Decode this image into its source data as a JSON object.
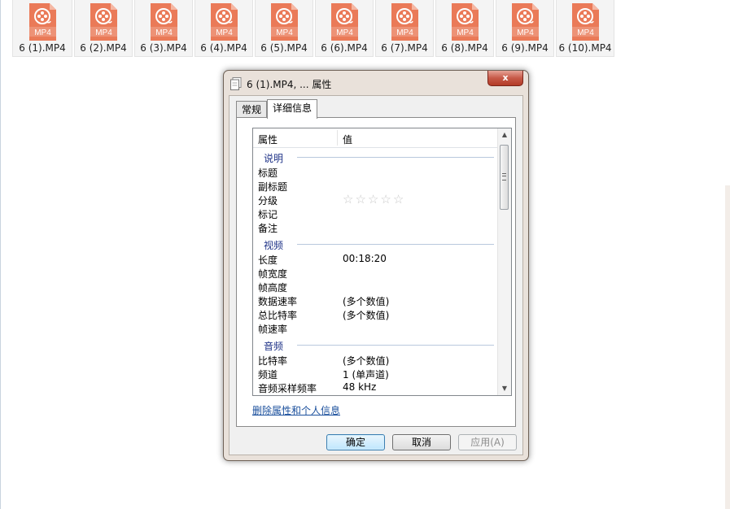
{
  "files": [
    {
      "name": "6 (1).MP4",
      "ext": "MP4"
    },
    {
      "name": "6 (2).MP4",
      "ext": "MP4"
    },
    {
      "name": "6 (3).MP4",
      "ext": "MP4"
    },
    {
      "name": "6 (4).MP4",
      "ext": "MP4"
    },
    {
      "name": "6 (5).MP4",
      "ext": "MP4"
    },
    {
      "name": "6 (6).MP4",
      "ext": "MP4"
    },
    {
      "name": "6 (7).MP4",
      "ext": "MP4"
    },
    {
      "name": "6 (8).MP4",
      "ext": "MP4"
    },
    {
      "name": "6 (9).MP4",
      "ext": "MP4"
    },
    {
      "name": "6 (10).MP4",
      "ext": "MP4"
    }
  ],
  "colors": {
    "file_icon": "#ea7a58",
    "group_heading": "#1e3287",
    "link": "#1a4f9c"
  },
  "dialog": {
    "title": "6 (1).MP4, ... 属性",
    "close_label": "x",
    "title_icon": "document-stack-icon",
    "tabs": [
      {
        "label": "常规"
      },
      {
        "label": "详细信息",
        "active": true
      }
    ],
    "columns": {
      "property": "属性",
      "value": "值"
    },
    "groups": [
      {
        "label": "说明",
        "rows": [
          {
            "key": "标题",
            "value": ""
          },
          {
            "key": "副标题",
            "value": ""
          },
          {
            "key": "分级",
            "value": "",
            "rating": 0,
            "rating_max": 5
          },
          {
            "key": "标记",
            "value": ""
          },
          {
            "key": "备注",
            "value": ""
          }
        ]
      },
      {
        "label": "视频",
        "rows": [
          {
            "key": "长度",
            "value": "00:18:20"
          },
          {
            "key": "帧宽度",
            "value": ""
          },
          {
            "key": "帧高度",
            "value": ""
          },
          {
            "key": "数据速率",
            "value": "(多个数值)"
          },
          {
            "key": "总比特率",
            "value": "(多个数值)"
          },
          {
            "key": "帧速率",
            "value": ""
          }
        ]
      },
      {
        "label": "音频",
        "rows": [
          {
            "key": "比特率",
            "value": "(多个数值)"
          },
          {
            "key": "频道",
            "value": "1 (单声道)"
          },
          {
            "key": "音频采样频率",
            "value": "48 kHz"
          }
        ]
      }
    ],
    "remove_link": "删除属性和个人信息",
    "buttons": {
      "ok": "确定",
      "cancel": "取消",
      "apply": "应用(A)"
    }
  }
}
